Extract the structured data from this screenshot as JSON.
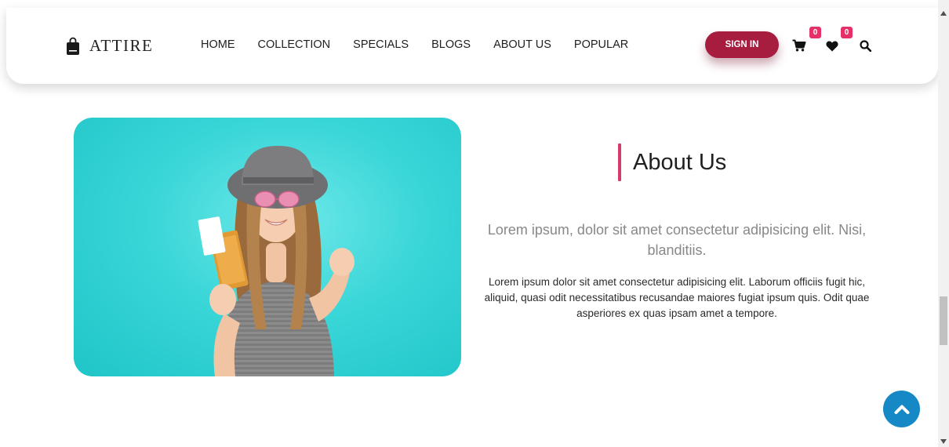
{
  "brand": {
    "name": "ATTIRE",
    "icon": "shopping-bag-icon"
  },
  "nav": {
    "items": [
      {
        "label": "HOME"
      },
      {
        "label": "COLLECTION"
      },
      {
        "label": "SPECIALS"
      },
      {
        "label": "BLOGS"
      },
      {
        "label": "ABOUT US"
      },
      {
        "label": "POPULAR"
      }
    ]
  },
  "header": {
    "signin_label": "SIGN IN",
    "cart": {
      "icon": "cart-icon",
      "count": "0"
    },
    "wishlist": {
      "icon": "heart-icon",
      "count": "0"
    },
    "search": {
      "icon": "search-icon"
    }
  },
  "about": {
    "title": "About Us",
    "lead": "Lorem ipsum, dolor sit amet consectetur adipisicing elit. Nisi, blanditiis.",
    "body": "Lorem ipsum dolor sit amet consectetur adipisicing elit. Laborum officiis fugit hic, aliquid, quasi odit necessitatibus recusandae maiores fugiat ipsum quis. Odit quae asperiores ex quas ipsam amet a tempore."
  },
  "hero_image": {
    "subject": "smiling woman in hat holding passport and ticket",
    "background_color": "#3ad6d8"
  },
  "scroll_top": {
    "icon": "chevron-up-icon"
  },
  "colors": {
    "accent": "#a61d3f",
    "badge": "#e5306a",
    "title_bar": "#d63c6a",
    "scroll_top_bg": "#1788c6"
  },
  "scrollbar": {
    "position": 0.68
  }
}
